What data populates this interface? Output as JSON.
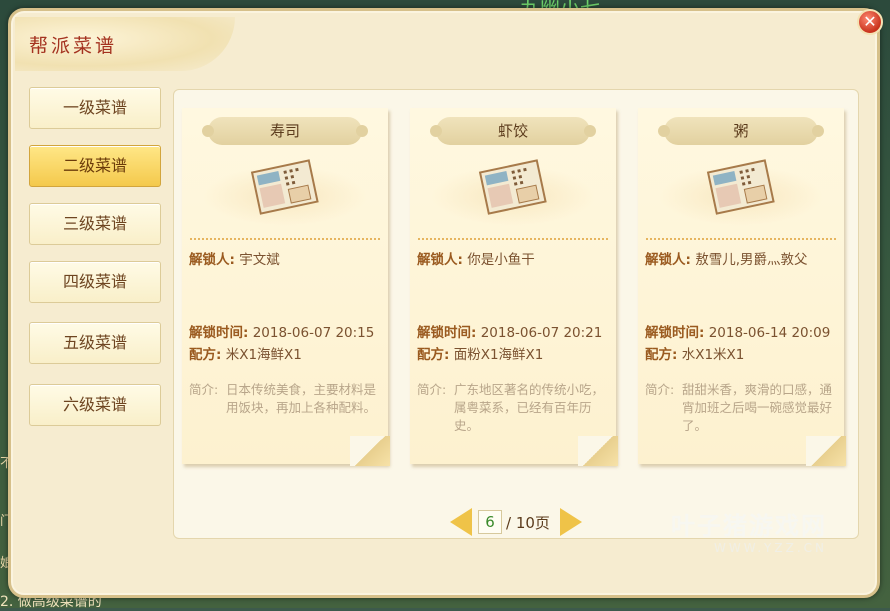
{
  "background": {
    "top_text": "九幽小七",
    "left_texts": [
      "不",
      "门",
      "娘"
    ],
    "bottom_text": "2. 做高级菜谱的"
  },
  "window": {
    "title": "帮派菜谱",
    "close_label": "✕"
  },
  "menu": {
    "items": [
      {
        "label": "一级菜谱",
        "active": false
      },
      {
        "label": "二级菜谱",
        "active": true
      },
      {
        "label": "三级菜谱",
        "active": false
      },
      {
        "label": "四级菜谱",
        "active": false
      },
      {
        "label": "五级菜谱",
        "active": false
      },
      {
        "label": "六级菜谱",
        "active": false
      }
    ]
  },
  "labels": {
    "unlocker": "解锁人:",
    "unlock_time": "解锁时间:",
    "recipe": "配方:",
    "intro": "简介:"
  },
  "cards": [
    {
      "name": "寿司",
      "unlocker": "宇文斌",
      "time": "2018-06-07 20:15",
      "recipe": "米X1海鲜X1",
      "intro": "日本传统美食，主要材料是用饭块，再加上各种配料。"
    },
    {
      "name": "虾饺",
      "unlocker": "你是小鱼干",
      "time": "2018-06-07 20:21",
      "recipe": "面粉X1海鲜X1",
      "intro": "广东地区著名的传统小吃，属粤菜系，已经有百年历史。"
    },
    {
      "name": "粥",
      "unlocker": "敖雪儿,男爵灬敦父",
      "time": "2018-06-14 20:09",
      "recipe": "水X1米X1",
      "intro": "甜甜米香，爽滑的口感，通宵加班之后喝一碗感觉最好了。"
    }
  ],
  "pager": {
    "current": "6",
    "total": "/ 10页"
  },
  "watermark": {
    "big": "叶子猪游戏网",
    "small": "WWW.YZZ.CN"
  },
  "colors": {
    "title": "#a4321f",
    "active_tab": "#f4c94c",
    "label": "#9a5a1f",
    "page_number": "#3a8a2b"
  }
}
